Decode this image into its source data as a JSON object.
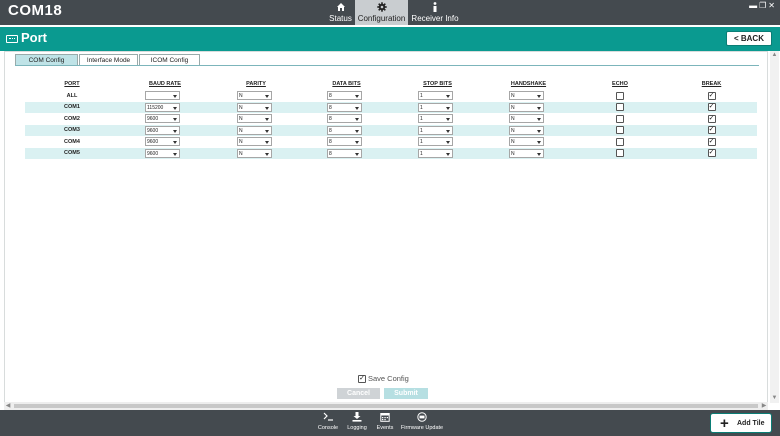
{
  "app": {
    "title": "COM18"
  },
  "nav": {
    "tabs": [
      {
        "label": "Status",
        "icon": "home-icon"
      },
      {
        "label": "Configuration",
        "icon": "gear-icon"
      },
      {
        "label": "Receiver Info",
        "icon": "info-icon"
      }
    ],
    "active": "Configuration"
  },
  "header": {
    "title": "Port",
    "back_label": "<  BACK"
  },
  "subtabs": [
    {
      "label": "COM Config",
      "active": true
    },
    {
      "label": "Interface Mode",
      "active": false
    },
    {
      "label": "ICOM Config",
      "active": false
    }
  ],
  "table": {
    "headers": [
      "PORT",
      "BAUD RATE",
      "PARITY",
      "DATA BITS",
      "STOP BITS",
      "HANDSHAKE",
      "ECHO",
      "BREAK"
    ],
    "rows": [
      {
        "port": "ALL",
        "baud": "",
        "parity": "N",
        "data_bits": "8",
        "stop_bits": "1",
        "handshake": "N",
        "echo": false,
        "break": true
      },
      {
        "port": "COM1",
        "baud": "115200",
        "parity": "N",
        "data_bits": "8",
        "stop_bits": "1",
        "handshake": "N",
        "echo": false,
        "break": true
      },
      {
        "port": "COM2",
        "baud": "9600",
        "parity": "N",
        "data_bits": "8",
        "stop_bits": "1",
        "handshake": "N",
        "echo": false,
        "break": true
      },
      {
        "port": "COM3",
        "baud": "9600",
        "parity": "N",
        "data_bits": "8",
        "stop_bits": "1",
        "handshake": "N",
        "echo": false,
        "break": true
      },
      {
        "port": "COM4",
        "baud": "9600",
        "parity": "N",
        "data_bits": "8",
        "stop_bits": "1",
        "handshake": "N",
        "echo": false,
        "break": true
      },
      {
        "port": "COM5",
        "baud": "9600",
        "parity": "N",
        "data_bits": "8",
        "stop_bits": "1",
        "handshake": "N",
        "echo": false,
        "break": true
      }
    ]
  },
  "save_config": {
    "label": "Save Config",
    "checked": true
  },
  "actions": {
    "cancel_label": "Cancel",
    "submit_label": "Submit"
  },
  "toolbar": {
    "tools": [
      {
        "label": "Console",
        "icon": "terminal-icon"
      },
      {
        "label": "Logging",
        "icon": "download-icon"
      },
      {
        "label": "Events",
        "icon": "calendar-icon"
      },
      {
        "label": "Firmware Update",
        "icon": "firmware-icon"
      }
    ],
    "add_tile_label": "Add Tile"
  },
  "colors": {
    "topbar": "#444a4f",
    "header": "#0a9a90",
    "row_alt": "#daf1f2",
    "tab_active": "#bfe3e7"
  }
}
